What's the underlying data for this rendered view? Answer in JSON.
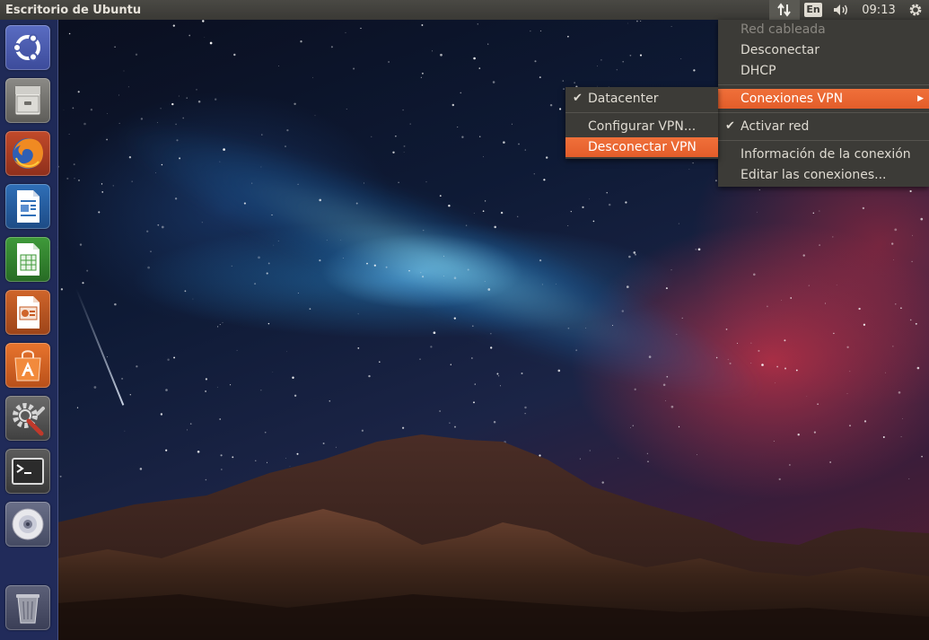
{
  "panel": {
    "title": "Escritorio de Ubuntu",
    "keyboard_layout": "En",
    "clock": "09:13",
    "icons": [
      "network-icon",
      "keyboard-layout-icon",
      "volume-icon",
      "session-gear-icon"
    ]
  },
  "network_menu": {
    "items": [
      {
        "label": "Red cableada",
        "disabled": true
      },
      {
        "label": "Desconectar"
      },
      {
        "label": "DHCP"
      },
      {
        "label": "Conexiones VPN",
        "highlighted": true,
        "submenu": true
      },
      {
        "label": "Activar red",
        "checked": true
      },
      {
        "label": "Información de la conexión"
      },
      {
        "label": "Editar las conexiones..."
      }
    ]
  },
  "vpn_submenu": {
    "items": [
      {
        "label": "Datacenter",
        "checked": true
      },
      {
        "label": "Configurar VPN..."
      },
      {
        "label": "Desconectar VPN",
        "highlighted": true
      }
    ]
  },
  "launcher": {
    "items": [
      {
        "name": "ubuntu-dash",
        "icon": "ubuntu-logo-icon"
      },
      {
        "name": "files",
        "icon": "file-cabinet-icon"
      },
      {
        "name": "firefox",
        "icon": "firefox-icon"
      },
      {
        "name": "libreoffice-writer",
        "icon": "writer-icon"
      },
      {
        "name": "libreoffice-calc",
        "icon": "calc-icon"
      },
      {
        "name": "libreoffice-impress",
        "icon": "impress-icon"
      },
      {
        "name": "ubuntu-software",
        "icon": "software-center-icon"
      },
      {
        "name": "system-settings",
        "icon": "settings-wrench-icon"
      },
      {
        "name": "terminal",
        "icon": "terminal-icon"
      },
      {
        "name": "optical-drive",
        "icon": "cd-drive-icon"
      },
      {
        "name": "trash",
        "icon": "trash-icon"
      }
    ]
  },
  "colors": {
    "panel_bg": "#3c3b37",
    "menu_bg": "#3c3b37",
    "highlight": "#e95420",
    "launcher_bg": "#222c5c",
    "text": "#dfdbd2"
  }
}
